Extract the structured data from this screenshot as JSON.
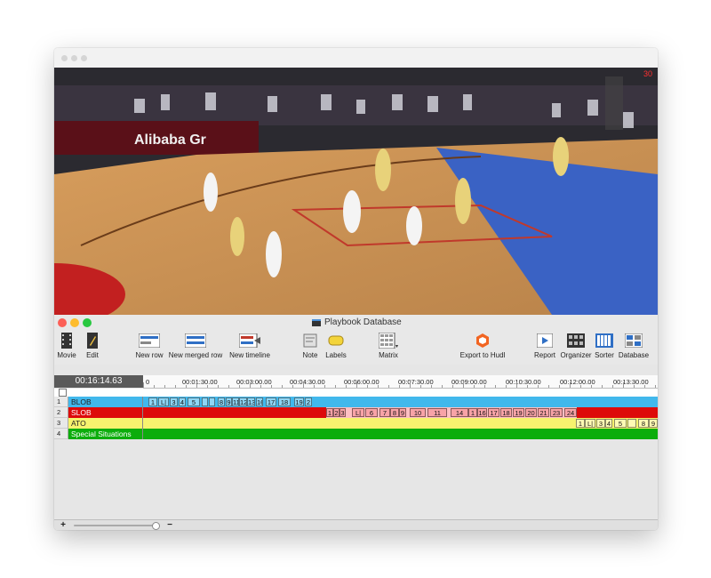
{
  "window": {
    "title": "Playbook Database"
  },
  "toolbar": {
    "items": [
      {
        "label": "Movie",
        "icon": "film-strip-icon"
      },
      {
        "label": "Edit",
        "icon": "pencil-icon"
      },
      {
        "label": "New row",
        "icon": "new-row-icon"
      },
      {
        "label": "New merged row",
        "icon": "merged-row-icon"
      },
      {
        "label": "New timeline",
        "icon": "new-timeline-icon"
      },
      {
        "label": "Note",
        "icon": "note-icon"
      },
      {
        "label": "Labels",
        "icon": "labels-icon"
      },
      {
        "label": "Matrix",
        "icon": "matrix-icon"
      },
      {
        "label": "Export to Hudl",
        "icon": "hudl-icon"
      },
      {
        "label": "Report",
        "icon": "report-icon"
      },
      {
        "label": "Organizer",
        "icon": "organizer-icon"
      },
      {
        "label": "Sorter",
        "icon": "sorter-icon"
      },
      {
        "label": "Database",
        "icon": "database-icon"
      }
    ]
  },
  "timeline": {
    "current_time": "00:16:14.63",
    "ruler_labels": [
      "0",
      "00:01:30.00",
      "00:03:00.00",
      "00:04:30.00",
      "00:06:00.00",
      "00:07:30.00",
      "00:09:00.00",
      "00:10:30.00",
      "00:12:00.00",
      "00:13:30.00"
    ],
    "rows": [
      {
        "num": "1",
        "name": "BLOB",
        "color": "#41b8ec",
        "clips": [
          "1",
          "L|",
          "3",
          "4",
          "5",
          "",
          "",
          "8",
          "9",
          "11",
          "12",
          "13",
          "16",
          "17",
          "18",
          "19",
          "2"
        ]
      },
      {
        "num": "2",
        "name": "SLOB",
        "color": "#dd0a0a",
        "clips": [
          "1",
          "2",
          "3",
          "L|",
          "6",
          "7",
          "8",
          "9",
          "10",
          "11",
          "14",
          "1",
          "16",
          "17",
          "18",
          "19",
          "20",
          "21",
          "23",
          "24"
        ]
      },
      {
        "num": "3",
        "name": "ATO",
        "color": "#f7f36e",
        "clips": [
          "1",
          "L|",
          "3",
          "4",
          "5",
          "",
          "8",
          "9"
        ]
      },
      {
        "num": "4",
        "name": "Special Situations",
        "color": "#0cad0c",
        "clips": []
      }
    ]
  },
  "footer": {
    "add_label": "+",
    "remove_label": "−"
  }
}
